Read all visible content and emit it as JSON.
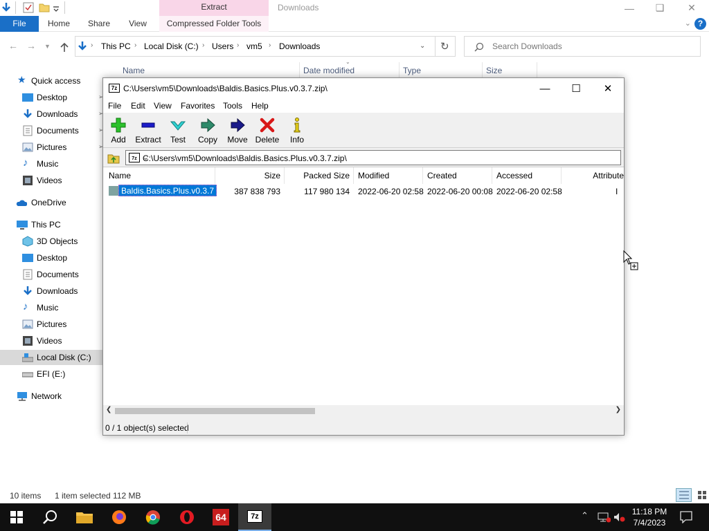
{
  "explorer": {
    "context_tab": "Extract",
    "window_title": "Downloads",
    "ribbon_tabs": [
      "File",
      "Home",
      "Share",
      "View",
      "Compressed Folder Tools"
    ],
    "breadcrumb": [
      "This PC",
      "Local Disk (C:)",
      "Users",
      "vm5",
      "Downloads"
    ],
    "search_placeholder": "Search Downloads",
    "columns": [
      "Name",
      "Date modified",
      "Type",
      "Size"
    ],
    "nav": {
      "quick_access": "Quick access",
      "quick_items": [
        "Desktop",
        "Downloads",
        "Documents",
        "Pictures",
        "Music",
        "Videos"
      ],
      "onedrive": "OneDrive",
      "this_pc": "This PC",
      "pc_items": [
        "3D Objects",
        "Desktop",
        "Documents",
        "Downloads",
        "Music",
        "Pictures",
        "Videos",
        "Local Disk (C:)",
        "EFI (E:)"
      ],
      "network": "Network"
    },
    "status": {
      "items": "10 items",
      "selected": "1 item selected  112 MB"
    }
  },
  "sevenzip": {
    "title": "C:\\Users\\vm5\\Downloads\\Baldis.Basics.Plus.v0.3.7.zip\\",
    "logo": "7z",
    "menu": [
      "File",
      "Edit",
      "View",
      "Favorites",
      "Tools",
      "Help"
    ],
    "toolbar": [
      "Add",
      "Extract",
      "Test",
      "Copy",
      "Move",
      "Delete",
      "Info"
    ],
    "path": "C:\\Users\\vm5\\Downloads\\Baldis.Basics.Plus.v0.3.7.zip\\",
    "columns": [
      "Name",
      "Size",
      "Packed Size",
      "Modified",
      "Created",
      "Accessed",
      "Attribute"
    ],
    "rows": [
      {
        "name": "Baldis.Basics.Plus.v0.3.7",
        "size": "387 838 793",
        "packed": "117 980 134",
        "modified": "2022-06-20 02:58",
        "created": "2022-06-20 00:08",
        "accessed": "2022-06-20 02:58",
        "attribute": "I"
      }
    ],
    "status": "0 / 1 object(s) selected"
  },
  "taskbar": {
    "apps": [
      "start",
      "search",
      "file-explorer",
      "firefox",
      "chrome",
      "opera",
      "aida64",
      "7zip"
    ],
    "aida_label": "64",
    "zip_label": "7z",
    "time": "11:18 PM",
    "date": "7/4/2023"
  },
  "colors": {
    "accent": "#1a6fc7",
    "context_tab": "#f9d6e8",
    "selection": "#0078d7",
    "taskbar": "#101010"
  }
}
